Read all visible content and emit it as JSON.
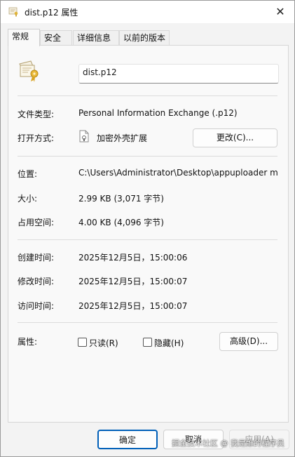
{
  "window": {
    "title": "dist.p12 属性",
    "close_glyph": "✕"
  },
  "tabs": [
    {
      "label": "常规"
    },
    {
      "label": "安全"
    },
    {
      "label": "详细信息"
    },
    {
      "label": "以前的版本"
    }
  ],
  "general": {
    "file_name": "dist.p12",
    "type_label": "文件类型:",
    "type_value": "Personal Information Exchange (.p12)",
    "opens_label": "打开方式:",
    "opens_value": "加密外壳扩展",
    "change_button": "更改(C)...",
    "location_label": "位置:",
    "location_value": "C:\\Users\\Administrator\\Desktop\\appuploader ma",
    "size_label": "大小:",
    "size_value": "2.99 KB (3,071 字节)",
    "size_on_disk_label": "占用空间:",
    "size_on_disk_value": "4.00 KB (4,096 字节)",
    "created_label": "创建时间:",
    "created_value": "2025年12月5日，15:00:06",
    "modified_label": "修改时间:",
    "modified_value": "2025年12月5日，15:00:07",
    "accessed_label": "访问时间:",
    "accessed_value": "2025年12月5日，15:00:07",
    "attributes_label": "属性:",
    "readonly_label": "只读(R)",
    "hidden_label": "隐藏(H)",
    "advanced_button": "高级(D)..."
  },
  "footer": {
    "ok_button": "确定",
    "cancel_button": "取消",
    "apply_button": "应用(A)"
  },
  "watermark": "掘金技术社区 @ 我是誰的程序员",
  "colors": {
    "accent": "#005fb8",
    "window_bg": "#f3f3f3",
    "panel_bg": "#f9f9f9"
  }
}
